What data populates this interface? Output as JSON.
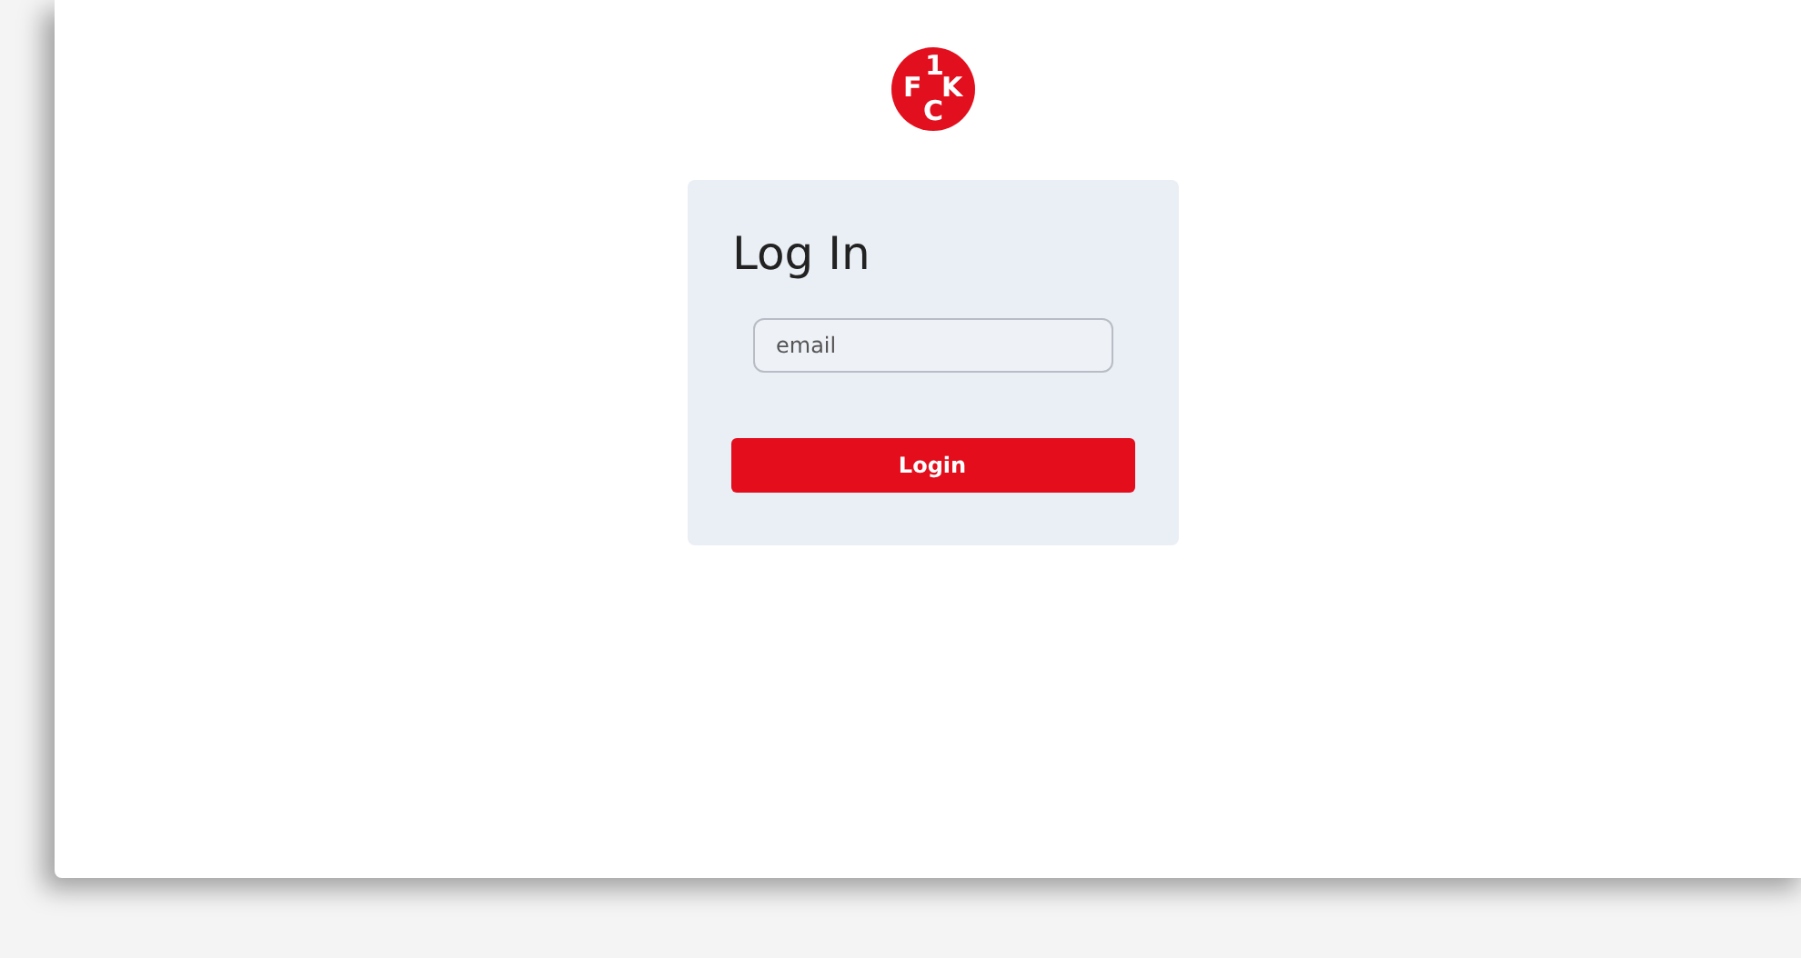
{
  "logo": {
    "letters": [
      "1",
      "F",
      "K",
      "C"
    ]
  },
  "login_card": {
    "title": "Log In",
    "email_field": {
      "placeholder": "email"
    },
    "submit_button": "Login"
  }
}
